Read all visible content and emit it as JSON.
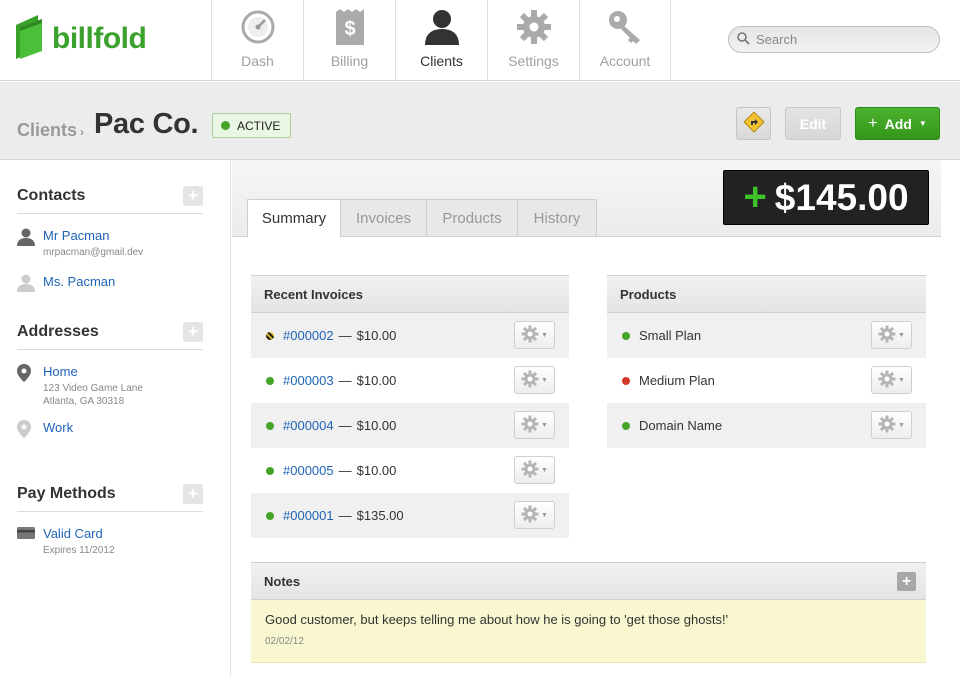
{
  "app": {
    "name": "billfold"
  },
  "nav": {
    "items": [
      {
        "label": "Dash",
        "icon": "dashboard-gauge-icon"
      },
      {
        "label": "Billing",
        "icon": "dollar-document-icon"
      },
      {
        "label": "Clients",
        "icon": "person-icon",
        "active": true
      },
      {
        "label": "Settings",
        "icon": "gear-icon"
      },
      {
        "label": "Account",
        "icon": "key-icon"
      }
    ]
  },
  "search": {
    "placeholder": "Search"
  },
  "header": {
    "breadcrumb": "Clients",
    "breadcrumb_sep": "›",
    "title": "Pac Co.",
    "status": "ACTIVE",
    "edit_label": "Edit",
    "add_label": "Add",
    "add_plus": "+"
  },
  "sidebar": {
    "contacts": {
      "title": "Contacts",
      "items": [
        {
          "name": "Mr Pacman",
          "email": "mrpacman@gmail.dev"
        },
        {
          "name": "Ms. Pacman"
        }
      ]
    },
    "addresses": {
      "title": "Addresses",
      "items": [
        {
          "label": "Home",
          "line1": "123 Video Game Lane",
          "line2": "Atlanta, GA 30318"
        },
        {
          "label": "Work"
        }
      ]
    },
    "pay_methods": {
      "title": "Pay Methods",
      "items": [
        {
          "label": "Valid Card",
          "detail": "Expires 11/2012"
        }
      ]
    }
  },
  "tabs": [
    "Summary",
    "Invoices",
    "Products",
    "History"
  ],
  "balance": {
    "sign": "+",
    "amount": "$145.00"
  },
  "recent_invoices": {
    "title": "Recent Invoices",
    "sep": "—",
    "items": [
      {
        "id": "#000002",
        "amount": "$10.00",
        "status": "pending"
      },
      {
        "id": "#000003",
        "amount": "$10.00",
        "status": "paid"
      },
      {
        "id": "#000004",
        "amount": "$10.00",
        "status": "paid"
      },
      {
        "id": "#000005",
        "amount": "$10.00",
        "status": "paid"
      },
      {
        "id": "#000001",
        "amount": "$135.00",
        "status": "paid"
      }
    ]
  },
  "products": {
    "title": "Products",
    "items": [
      {
        "name": "Small Plan",
        "status": "active"
      },
      {
        "name": "Medium Plan",
        "status": "inactive"
      },
      {
        "name": "Domain Name",
        "status": "active"
      }
    ]
  },
  "notes": {
    "title": "Notes",
    "text": "Good customer, but keeps telling me about how he is going to 'get those ghosts!'",
    "date": "02/02/12"
  },
  "colors": {
    "brand": "#3aa12c",
    "link": "#1f64b8",
    "active_dot": "#45a329",
    "inactive_dot": "#d43a2a",
    "notes_bg": "#f8f7d0"
  }
}
